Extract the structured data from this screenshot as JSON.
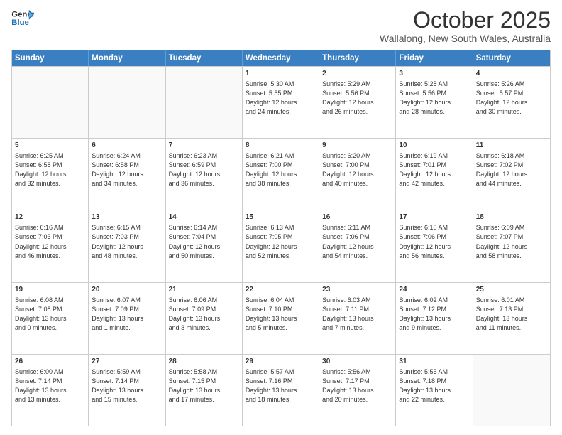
{
  "logo": {
    "line1": "General",
    "line2": "Blue"
  },
  "title": "October 2025",
  "subtitle": "Wallalong, New South Wales, Australia",
  "headers": [
    "Sunday",
    "Monday",
    "Tuesday",
    "Wednesday",
    "Thursday",
    "Friday",
    "Saturday"
  ],
  "weeks": [
    [
      {
        "date": "",
        "info": ""
      },
      {
        "date": "",
        "info": ""
      },
      {
        "date": "",
        "info": ""
      },
      {
        "date": "1",
        "info": "Sunrise: 5:30 AM\nSunset: 5:55 PM\nDaylight: 12 hours\nand 24 minutes."
      },
      {
        "date": "2",
        "info": "Sunrise: 5:29 AM\nSunset: 5:56 PM\nDaylight: 12 hours\nand 26 minutes."
      },
      {
        "date": "3",
        "info": "Sunrise: 5:28 AM\nSunset: 5:56 PM\nDaylight: 12 hours\nand 28 minutes."
      },
      {
        "date": "4",
        "info": "Sunrise: 5:26 AM\nSunset: 5:57 PM\nDaylight: 12 hours\nand 30 minutes."
      }
    ],
    [
      {
        "date": "5",
        "info": "Sunrise: 6:25 AM\nSunset: 6:58 PM\nDaylight: 12 hours\nand 32 minutes."
      },
      {
        "date": "6",
        "info": "Sunrise: 6:24 AM\nSunset: 6:58 PM\nDaylight: 12 hours\nand 34 minutes."
      },
      {
        "date": "7",
        "info": "Sunrise: 6:23 AM\nSunset: 6:59 PM\nDaylight: 12 hours\nand 36 minutes."
      },
      {
        "date": "8",
        "info": "Sunrise: 6:21 AM\nSunset: 7:00 PM\nDaylight: 12 hours\nand 38 minutes."
      },
      {
        "date": "9",
        "info": "Sunrise: 6:20 AM\nSunset: 7:00 PM\nDaylight: 12 hours\nand 40 minutes."
      },
      {
        "date": "10",
        "info": "Sunrise: 6:19 AM\nSunset: 7:01 PM\nDaylight: 12 hours\nand 42 minutes."
      },
      {
        "date": "11",
        "info": "Sunrise: 6:18 AM\nSunset: 7:02 PM\nDaylight: 12 hours\nand 44 minutes."
      }
    ],
    [
      {
        "date": "12",
        "info": "Sunrise: 6:16 AM\nSunset: 7:03 PM\nDaylight: 12 hours\nand 46 minutes."
      },
      {
        "date": "13",
        "info": "Sunrise: 6:15 AM\nSunset: 7:03 PM\nDaylight: 12 hours\nand 48 minutes."
      },
      {
        "date": "14",
        "info": "Sunrise: 6:14 AM\nSunset: 7:04 PM\nDaylight: 12 hours\nand 50 minutes."
      },
      {
        "date": "15",
        "info": "Sunrise: 6:13 AM\nSunset: 7:05 PM\nDaylight: 12 hours\nand 52 minutes."
      },
      {
        "date": "16",
        "info": "Sunrise: 6:11 AM\nSunset: 7:06 PM\nDaylight: 12 hours\nand 54 minutes."
      },
      {
        "date": "17",
        "info": "Sunrise: 6:10 AM\nSunset: 7:06 PM\nDaylight: 12 hours\nand 56 minutes."
      },
      {
        "date": "18",
        "info": "Sunrise: 6:09 AM\nSunset: 7:07 PM\nDaylight: 12 hours\nand 58 minutes."
      }
    ],
    [
      {
        "date": "19",
        "info": "Sunrise: 6:08 AM\nSunset: 7:08 PM\nDaylight: 13 hours\nand 0 minutes."
      },
      {
        "date": "20",
        "info": "Sunrise: 6:07 AM\nSunset: 7:09 PM\nDaylight: 13 hours\nand 1 minute."
      },
      {
        "date": "21",
        "info": "Sunrise: 6:06 AM\nSunset: 7:09 PM\nDaylight: 13 hours\nand 3 minutes."
      },
      {
        "date": "22",
        "info": "Sunrise: 6:04 AM\nSunset: 7:10 PM\nDaylight: 13 hours\nand 5 minutes."
      },
      {
        "date": "23",
        "info": "Sunrise: 6:03 AM\nSunset: 7:11 PM\nDaylight: 13 hours\nand 7 minutes."
      },
      {
        "date": "24",
        "info": "Sunrise: 6:02 AM\nSunset: 7:12 PM\nDaylight: 13 hours\nand 9 minutes."
      },
      {
        "date": "25",
        "info": "Sunrise: 6:01 AM\nSunset: 7:13 PM\nDaylight: 13 hours\nand 11 minutes."
      }
    ],
    [
      {
        "date": "26",
        "info": "Sunrise: 6:00 AM\nSunset: 7:14 PM\nDaylight: 13 hours\nand 13 minutes."
      },
      {
        "date": "27",
        "info": "Sunrise: 5:59 AM\nSunset: 7:14 PM\nDaylight: 13 hours\nand 15 minutes."
      },
      {
        "date": "28",
        "info": "Sunrise: 5:58 AM\nSunset: 7:15 PM\nDaylight: 13 hours\nand 17 minutes."
      },
      {
        "date": "29",
        "info": "Sunrise: 5:57 AM\nSunset: 7:16 PM\nDaylight: 13 hours\nand 18 minutes."
      },
      {
        "date": "30",
        "info": "Sunrise: 5:56 AM\nSunset: 7:17 PM\nDaylight: 13 hours\nand 20 minutes."
      },
      {
        "date": "31",
        "info": "Sunrise: 5:55 AM\nSunset: 7:18 PM\nDaylight: 13 hours\nand 22 minutes."
      },
      {
        "date": "",
        "info": ""
      }
    ]
  ]
}
